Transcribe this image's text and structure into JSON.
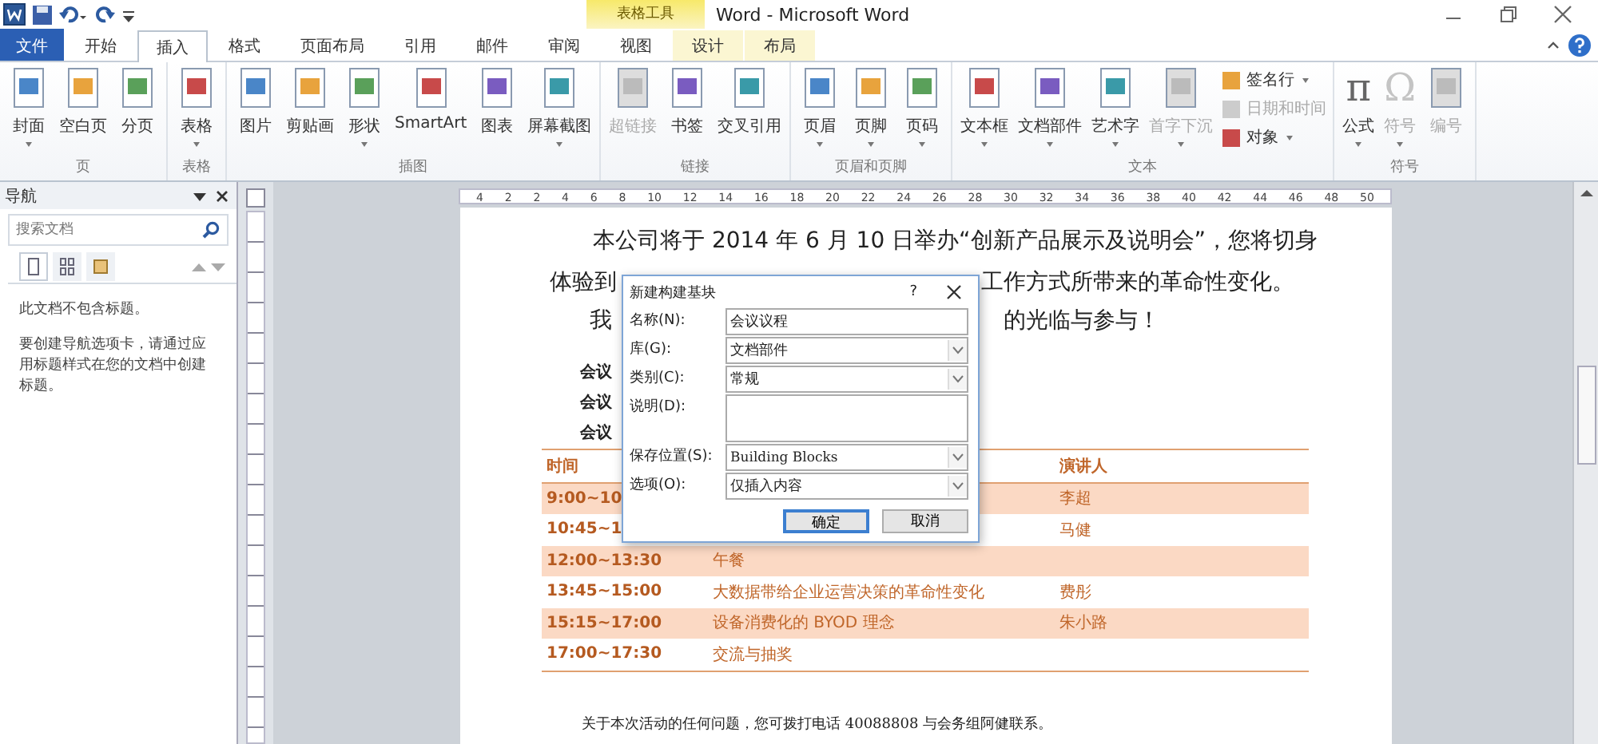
{
  "window": {
    "title": "Word - Microsoft Word",
    "context_label": "表格工具"
  },
  "tabs": [
    {
      "label": "文件",
      "kind": "file",
      "selected": false
    },
    {
      "label": "开始",
      "kind": "normal",
      "selected": false
    },
    {
      "label": "插入",
      "kind": "normal",
      "selected": true
    },
    {
      "label": "格式",
      "kind": "normal",
      "selected": false
    },
    {
      "label": "页面布局",
      "kind": "normal",
      "selected": false
    },
    {
      "label": "引用",
      "kind": "normal",
      "selected": false
    },
    {
      "label": "邮件",
      "kind": "normal",
      "selected": false
    },
    {
      "label": "审阅",
      "kind": "normal",
      "selected": false
    },
    {
      "label": "视图",
      "kind": "normal",
      "selected": false
    },
    {
      "label": "设计",
      "kind": "context",
      "selected": false
    },
    {
      "label": "布局",
      "kind": "context",
      "selected": false
    }
  ],
  "ribbon": [
    {
      "label": "页",
      "items": [
        {
          "label": "封面",
          "kind": "large",
          "dropdown": true,
          "disabled": false
        },
        {
          "label": "空白页",
          "kind": "large",
          "dropdown": false,
          "disabled": false
        },
        {
          "label": "分页",
          "kind": "large",
          "dropdown": false,
          "disabled": false
        }
      ]
    },
    {
      "label": "表格",
      "items": [
        {
          "label": "表格",
          "kind": "large",
          "dropdown": true,
          "disabled": false
        }
      ]
    },
    {
      "label": "插图",
      "items": [
        {
          "label": "图片",
          "kind": "large",
          "dropdown": false,
          "disabled": false
        },
        {
          "label": "剪贴画",
          "kind": "large",
          "dropdown": false,
          "disabled": false
        },
        {
          "label": "形状",
          "kind": "large",
          "dropdown": true,
          "disabled": false
        },
        {
          "label": "SmartArt",
          "kind": "large",
          "dropdown": false,
          "disabled": false
        },
        {
          "label": "图表",
          "kind": "large",
          "dropdown": false,
          "disabled": false
        },
        {
          "label": "屏幕截图",
          "kind": "large",
          "dropdown": true,
          "disabled": false
        }
      ]
    },
    {
      "label": "链接",
      "items": [
        {
          "label": "超链接",
          "kind": "large",
          "dropdown": false,
          "disabled": true
        },
        {
          "label": "书签",
          "kind": "large",
          "dropdown": false,
          "disabled": false
        },
        {
          "label": "交叉引用",
          "kind": "large",
          "dropdown": false,
          "disabled": false
        }
      ]
    },
    {
      "label": "页眉和页脚",
      "items": [
        {
          "label": "页眉",
          "kind": "large",
          "dropdown": true,
          "disabled": false
        },
        {
          "label": "页脚",
          "kind": "large",
          "dropdown": true,
          "disabled": false
        },
        {
          "label": "页码",
          "kind": "large",
          "dropdown": true,
          "disabled": false
        }
      ]
    },
    {
      "label": "文本",
      "items": [
        {
          "label": "文本框",
          "kind": "large",
          "dropdown": true,
          "disabled": false
        },
        {
          "label": "文档部件",
          "kind": "large",
          "dropdown": true,
          "disabled": false
        },
        {
          "label": "艺术字",
          "kind": "large",
          "dropdown": true,
          "disabled": false
        },
        {
          "label": "首字下沉",
          "kind": "large",
          "dropdown": true,
          "disabled": true
        },
        {
          "label": "签名行",
          "kind": "small",
          "dropdown": true,
          "disabled": false
        },
        {
          "label": "日期和时间",
          "kind": "small",
          "dropdown": false,
          "disabled": true
        },
        {
          "label": "对象",
          "kind": "small",
          "dropdown": true,
          "disabled": false
        }
      ]
    },
    {
      "label": "符号",
      "items": [
        {
          "label": "公式",
          "kind": "large",
          "dropdown": true,
          "disabled": false,
          "glyph": "π"
        },
        {
          "label": "符号",
          "kind": "large",
          "dropdown": true,
          "disabled": true,
          "glyph": "Ω"
        },
        {
          "label": "编号",
          "kind": "large",
          "dropdown": false,
          "disabled": true
        }
      ]
    }
  ],
  "navigation": {
    "title": "导航",
    "search": {
      "placeholder": "搜索文档"
    },
    "tabs": [
      {
        "selected": true
      },
      {
        "selected": false
      },
      {
        "selected": false
      }
    ],
    "message": "此文档不包含标题。",
    "hint": "要创建导航选项卡，请通过应用标题样式在您的文档中创建标题。"
  },
  "ruler": {
    "labels": [
      "4",
      "2",
      "2",
      "4",
      "6",
      "8",
      "10",
      "12",
      "14",
      "16",
      "18",
      "20",
      "22",
      "24",
      "26",
      "28",
      "30",
      "32",
      "34",
      "36",
      "38",
      "40",
      "42",
      "44",
      "46",
      "48",
      "50"
    ]
  },
  "document": {
    "intro": "本公司将于 2014 年 6 月 10 日举办“创新产品展示及说明会”，您将切身",
    "line2_left": "体验到",
    "line2_right": "工作方式所带来的革命性变化。",
    "line3_left": "我",
    "line3_right": "的光临与参与！",
    "labels": [
      "会议",
      "会议",
      "会议"
    ],
    "table": {
      "columns": [
        "时间",
        "演讲人"
      ],
      "rows": [
        {
          "time": "9:00~10",
          "speaker": "李超",
          "shaded": true
        },
        {
          "time": "10:45~1",
          "speaker": "马健",
          "shaded": false
        },
        {
          "time": "12:00~13:30",
          "topic": "午餐",
          "shaded": true
        },
        {
          "time": "13:45~15:00",
          "topic": "大数据带给企业运营决策的革命性变化",
          "speaker": "费彤",
          "shaded": false
        },
        {
          "time": "15:15~17:00",
          "topic": "设备消费化的 BYOD 理念",
          "speaker": "朱小路",
          "shaded": true
        },
        {
          "time": "17:00~17:30",
          "topic": "交流与抽奖",
          "shaded": false
        }
      ]
    },
    "footer": "关于本次活动的任何问题，您可拨打电话 40088808 与会务组阿健联系。"
  },
  "dialog": {
    "title": "新建构建基块",
    "help": "?",
    "fields": [
      {
        "label": "名称(N):",
        "value": "会议议程",
        "kind": "text"
      },
      {
        "label": "库(G):",
        "value": "文档部件",
        "kind": "select"
      },
      {
        "label": "类别(C):",
        "value": "常规",
        "kind": "select"
      },
      {
        "label": "说明(D):",
        "kind": "area"
      },
      {
        "label": "保存位置(S):",
        "value": "Building Blocks",
        "kind": "select"
      },
      {
        "label": "选项(O):",
        "value": "仅插入内容",
        "kind": "select"
      }
    ],
    "buttons": [
      {
        "label": "确定",
        "default": true
      },
      {
        "label": "取消",
        "default": false
      }
    ]
  }
}
